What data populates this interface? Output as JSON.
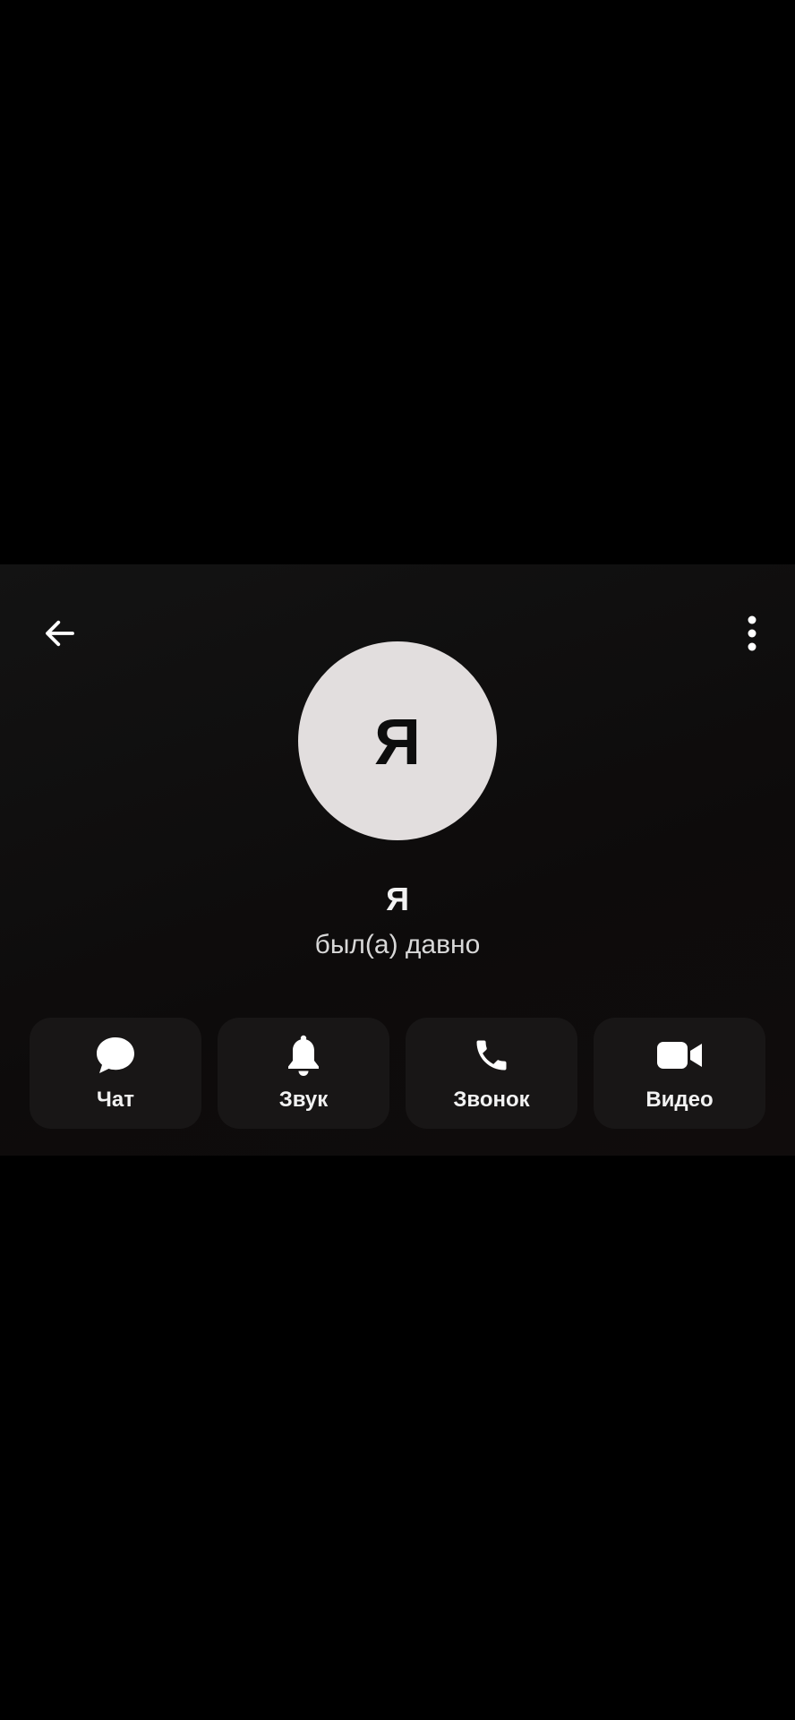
{
  "header": {
    "back_icon": "arrow-left-icon",
    "menu_icon": "more-vertical-icon"
  },
  "profile": {
    "avatar_letter": "Я",
    "name": "Я",
    "status": "был(а) давно"
  },
  "actions": [
    {
      "label": "Чат",
      "icon": "chat-bubble-icon"
    },
    {
      "label": "Звук",
      "icon": "bell-icon"
    },
    {
      "label": "Звонок",
      "icon": "phone-icon"
    },
    {
      "label": "Видео",
      "icon": "video-camera-icon"
    }
  ],
  "colors": {
    "background": "#000000",
    "card": "#111010",
    "button": "#181616",
    "avatar": "#e2dede",
    "text": "#f2f2f2"
  }
}
